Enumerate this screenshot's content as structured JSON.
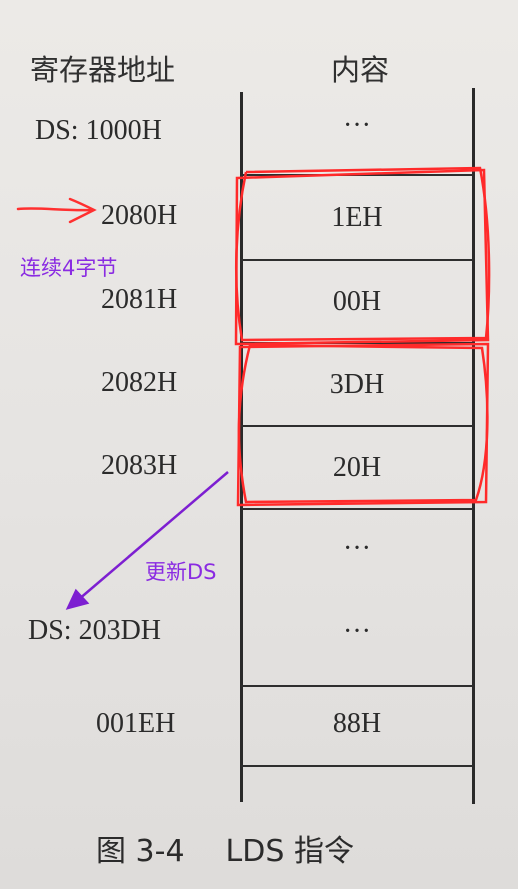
{
  "header": {
    "address_col": "寄存器地址",
    "content_col": "内容"
  },
  "rows": [
    {
      "address": "DS: 1000H",
      "content": "···"
    },
    {
      "address": "2080H",
      "content": "1EH"
    },
    {
      "address": "2081H",
      "content": "00H"
    },
    {
      "address": "2082H",
      "content": "3DH"
    },
    {
      "address": "2083H",
      "content": "20H"
    },
    {
      "address": "",
      "content": "···"
    },
    {
      "address": "DS: 203DH",
      "content": "···"
    },
    {
      "address": "001EH",
      "content": "88H"
    }
  ],
  "annotations": {
    "consecutive_bytes": "连续4字节",
    "update_ds": "更新DS"
  },
  "caption": {
    "figure_number": "图 3-4",
    "title": "LDS 指令"
  },
  "colors": {
    "highlight_red": "#ff2a2a",
    "annotation_purple": "#8a2be2"
  }
}
